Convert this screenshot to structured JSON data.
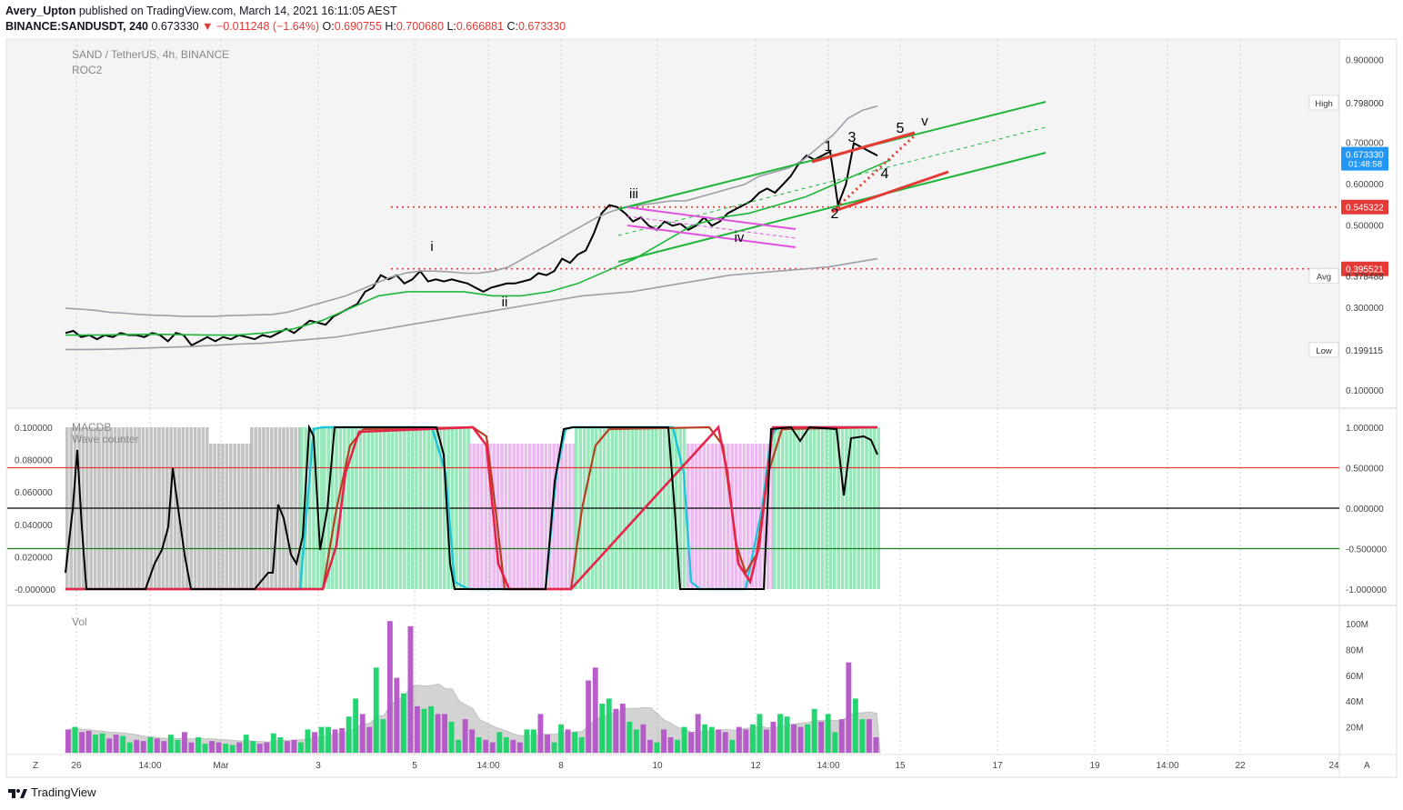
{
  "header": {
    "author": "Avery_Upton",
    "published_text": "published on TradingView.com, March 14, 2021 16:11:05 AEST",
    "symbol": "BINANCE:SANDUSDT, 240",
    "last": "0.673330",
    "change": "▼ −0.011248 (−1.64%)",
    "o_label": "O:",
    "o": "0.690755",
    "h_label": "H:",
    "h": "0.700680",
    "l_label": "L:",
    "l": "0.666881",
    "c_label": "C:",
    "c": "0.673330"
  },
  "chart_data": [
    {
      "type": "line",
      "title": "SAND / TetherUS, 4h, BINANCE",
      "indicator": "ROC2",
      "y_scale": "linear",
      "ylim": [
        0.06,
        0.95
      ],
      "y_ticks": [
        "0.900000",
        "0.700000",
        "0.600000",
        "0.500000",
        "0.300000",
        "0.100000"
      ],
      "y_tick_values": [
        0.9,
        0.7,
        0.6,
        0.5,
        0.3,
        0.1
      ],
      "x_tick_labels": [
        "26",
        "14:00",
        "Mar",
        "3",
        "5",
        "14:00",
        "8",
        "10",
        "12",
        "14:00",
        "15",
        "17",
        "19",
        "14:00",
        "22",
        "24"
      ],
      "series": [
        {
          "name": "close",
          "color": "#000000",
          "values": [
            0.24,
            0.245,
            0.23,
            0.235,
            0.225,
            0.235,
            0.23,
            0.24,
            0.235,
            0.235,
            0.23,
            0.24,
            0.235,
            0.22,
            0.24,
            0.235,
            0.21,
            0.22,
            0.23,
            0.22,
            0.23,
            0.225,
            0.235,
            0.23,
            0.225,
            0.235,
            0.23,
            0.24,
            0.25,
            0.24,
            0.255,
            0.27,
            0.265,
            0.26,
            0.28,
            0.29,
            0.3,
            0.31,
            0.34,
            0.35,
            0.38,
            0.37,
            0.38,
            0.36,
            0.37,
            0.39,
            0.365,
            0.37,
            0.365,
            0.37,
            0.365,
            0.36,
            0.35,
            0.34,
            0.35,
            0.355,
            0.36,
            0.36,
            0.365,
            0.37,
            0.385,
            0.38,
            0.39,
            0.42,
            0.41,
            0.43,
            0.44,
            0.48,
            0.53,
            0.55,
            0.545,
            0.53,
            0.51,
            0.52,
            0.5,
            0.49,
            0.51,
            0.5,
            0.505,
            0.49,
            0.5,
            0.52,
            0.5,
            0.51,
            0.53,
            0.54,
            0.55,
            0.56,
            0.58,
            0.59,
            0.58,
            0.6,
            0.62,
            0.65,
            0.67,
            0.66,
            0.67,
            0.68,
            0.55,
            0.6,
            0.7,
            0.69,
            0.68,
            0.67
          ]
        },
        {
          "name": "bb_upper",
          "color": "#9e9ea8",
          "values": [
            0.3,
            0.298,
            0.295,
            0.29,
            0.288,
            0.285,
            0.283,
            0.282,
            0.28,
            0.28,
            0.28,
            0.282,
            0.283,
            0.284,
            0.285,
            0.29,
            0.3,
            0.31,
            0.32,
            0.33,
            0.345,
            0.36,
            0.375,
            0.385,
            0.39,
            0.39,
            0.388,
            0.385,
            0.385,
            0.39,
            0.4,
            0.42,
            0.44,
            0.46,
            0.48,
            0.5,
            0.52,
            0.535,
            0.545,
            0.55,
            0.555,
            0.56,
            0.56,
            0.57,
            0.58,
            0.59,
            0.6,
            0.62,
            0.63,
            0.64,
            0.66,
            0.69,
            0.72,
            0.76,
            0.78,
            0.79
          ]
        },
        {
          "name": "bb_lower",
          "color": "#9e9ea8",
          "values": [
            0.2,
            0.2,
            0.201,
            0.203,
            0.205,
            0.207,
            0.21,
            0.213,
            0.215,
            0.22,
            0.225,
            0.23,
            0.24,
            0.25,
            0.26,
            0.27,
            0.28,
            0.29,
            0.3,
            0.31,
            0.32,
            0.33,
            0.335,
            0.34,
            0.35,
            0.36,
            0.37,
            0.38,
            0.385,
            0.39,
            0.395,
            0.4,
            0.41,
            0.42
          ]
        },
        {
          "name": "ma",
          "color": "#1fb53a",
          "values": [
            0.235,
            0.235,
            0.236,
            0.237,
            0.236,
            0.235,
            0.235,
            0.24,
            0.25,
            0.27,
            0.3,
            0.33,
            0.34,
            0.34,
            0.34,
            0.33,
            0.33,
            0.34,
            0.36,
            0.39,
            0.42,
            0.46,
            0.5,
            0.52,
            0.53,
            0.55,
            0.57,
            0.6,
            0.63,
            0.66
          ]
        }
      ],
      "annotations": [
        "i",
        "ii",
        "iii",
        "iv",
        "v",
        "1",
        "2",
        "3",
        "4",
        "5"
      ],
      "price_labels": [
        {
          "tag": "High",
          "value": "0.798000"
        },
        {
          "tag": "",
          "value": "0.673330",
          "sub": "01:48:58"
        },
        {
          "tag": "",
          "value": "0.545322"
        },
        {
          "tag": "",
          "value": "0.395521"
        },
        {
          "tag": "Avg",
          "value": "0.378488"
        },
        {
          "tag": "Low",
          "value": "0.199115"
        }
      ],
      "h_lines": [
        0.545322,
        0.395521
      ]
    },
    {
      "type": "line",
      "title": "MACDB",
      "subtitle": "Wave counter",
      "ylim_left": [
        -0.005,
        0.105
      ],
      "left_ticks": [
        "0.100000",
        "0.080000",
        "0.060000",
        "0.040000",
        "0.020000",
        "-0.000000"
      ],
      "right_ticks": [
        "1.000000",
        "0.500000",
        "0.000000",
        "-0.500000",
        "-1.000000"
      ],
      "levels": [
        0.5,
        0.0,
        -0.5
      ],
      "level_colors": [
        "#e53935",
        "#000000",
        "#1b7a1b"
      ]
    },
    {
      "type": "bar",
      "title": "Vol",
      "y_ticks": [
        "100M",
        "80M",
        "60M",
        "40M",
        "20M"
      ],
      "values_millions": [
        18,
        20,
        16,
        17,
        14,
        15,
        11,
        14,
        13,
        8,
        10,
        9,
        12,
        11,
        9,
        14,
        10,
        16,
        8,
        12,
        7,
        9,
        8,
        7,
        6,
        8,
        14,
        9,
        7,
        8,
        15,
        12,
        9,
        10,
        8,
        18,
        16,
        20,
        20,
        18,
        19,
        28,
        42,
        30,
        20,
        66,
        26,
        102,
        58,
        46,
        98,
        36,
        34,
        36,
        30,
        30,
        24,
        10,
        26,
        18,
        12,
        10,
        8,
        16,
        12,
        10,
        8,
        18,
        18,
        30,
        14,
        8,
        22,
        18,
        16,
        12,
        56,
        66,
        38,
        42,
        34,
        38,
        24,
        18,
        22,
        10,
        8,
        18,
        12,
        10,
        20,
        16,
        30,
        22,
        20,
        18,
        16,
        10,
        20,
        18,
        22,
        30,
        18,
        24,
        30,
        28,
        22,
        20,
        22,
        34,
        24,
        30,
        16,
        26,
        70,
        42,
        26,
        26,
        12
      ]
    }
  ],
  "axis": {
    "left_corner": "Z",
    "right_corner": "A"
  },
  "footer": {
    "brand": "TradingView"
  }
}
